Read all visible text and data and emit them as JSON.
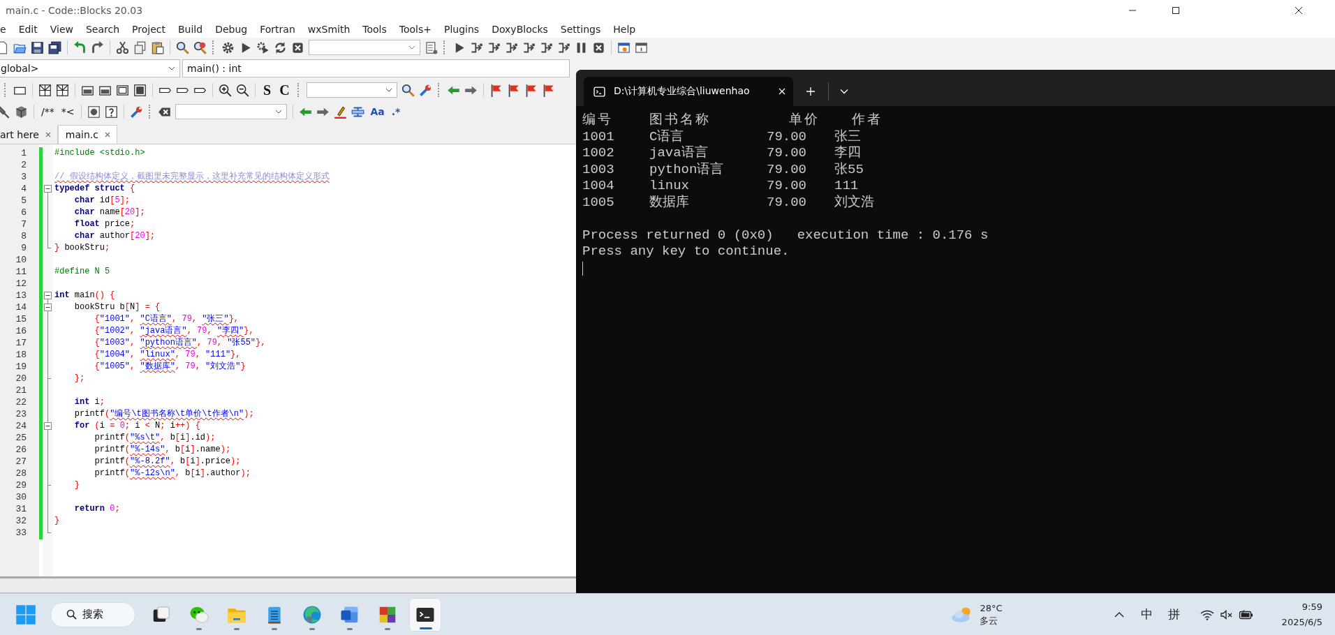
{
  "window": {
    "title": "main.c - Code::Blocks 20.03"
  },
  "menu": [
    "e",
    "Edit",
    "View",
    "Search",
    "Project",
    "Build",
    "Debug",
    "Fortran",
    "wxSmith",
    "Tools",
    "Tools+",
    "Plugins",
    "DoxyBlocks",
    "Settings",
    "Help"
  ],
  "toolbars": {
    "scope": "global>",
    "function": "main() : int",
    "wx_labels": [
      "S",
      "C"
    ],
    "doc_labels": [
      "/**",
      "*<"
    ],
    "search_labels": [
      "Aa",
      ".*"
    ]
  },
  "editor_tabs": [
    {
      "label": "art here",
      "selected": false
    },
    {
      "label": "main.c",
      "selected": true
    }
  ],
  "code": [
    {
      "number": "1",
      "tokens": [
        {
          "kind": "pp",
          "text": "#include <stdio.h>"
        }
      ]
    },
    {
      "number": "2"
    },
    {
      "number": "3",
      "tokens": [
        {
          "kind": "cm",
          "text": "// 假设结构体定义，截图里未完整显示，这里补充常见的结构体定义形式",
          "flagged": true
        }
      ]
    },
    {
      "number": "4",
      "collapsible": true,
      "tokens": [
        {
          "kind": "kw",
          "text": "typedef struct "
        },
        {
          "kind": "op",
          "text": "{"
        }
      ]
    },
    {
      "number": "5",
      "tokens": [
        {
          "kind": "kw",
          "text": "    char"
        },
        {
          "kind": "tx",
          "text": " id"
        },
        {
          "kind": "op",
          "text": "["
        },
        {
          "kind": "num",
          "text": "5"
        },
        {
          "kind": "op",
          "text": "];"
        }
      ]
    },
    {
      "number": "6",
      "tokens": [
        {
          "kind": "kw",
          "text": "    char"
        },
        {
          "kind": "tx",
          "text": " name"
        },
        {
          "kind": "op",
          "text": "["
        },
        {
          "kind": "num",
          "text": "20"
        },
        {
          "kind": "op",
          "text": "];"
        }
      ]
    },
    {
      "number": "7",
      "tokens": [
        {
          "kind": "kw",
          "text": "    float"
        },
        {
          "kind": "tx",
          "text": " price"
        },
        {
          "kind": "op",
          "text": ";"
        }
      ]
    },
    {
      "number": "8",
      "tokens": [
        {
          "kind": "kw",
          "text": "    char"
        },
        {
          "kind": "tx",
          "text": " author"
        },
        {
          "kind": "op",
          "text": "["
        },
        {
          "kind": "num",
          "text": "20"
        },
        {
          "kind": "op",
          "text": "];"
        }
      ]
    },
    {
      "number": "9",
      "fold_end": true,
      "tokens": [
        {
          "kind": "op",
          "text": "}"
        },
        {
          "kind": "tx",
          "text": " bookStru"
        },
        {
          "kind": "op",
          "text": ";"
        }
      ]
    },
    {
      "number": "10"
    },
    {
      "number": "11",
      "tokens": [
        {
          "kind": "pp",
          "text": "#define N 5"
        }
      ]
    },
    {
      "number": "12"
    },
    {
      "number": "13",
      "collapsible": true,
      "tokens": [
        {
          "kind": "kw",
          "text": "int"
        },
        {
          "kind": "tx",
          "text": " main"
        },
        {
          "kind": "op",
          "text": "() {"
        }
      ]
    },
    {
      "number": "14",
      "collapsible": true,
      "tokens": [
        {
          "kind": "tx",
          "text": "    bookStru b"
        },
        {
          "kind": "op",
          "text": "["
        },
        {
          "kind": "tx",
          "text": "N"
        },
        {
          "kind": "op",
          "text": "] = {"
        }
      ]
    },
    {
      "number": "15",
      "tokens": [
        {
          "kind": "op",
          "text": "        {"
        },
        {
          "kind": "str",
          "text": "\"1001\""
        },
        {
          "kind": "op",
          "text": ", "
        },
        {
          "kind": "str",
          "text": "\"C语言\"",
          "flagged": true
        },
        {
          "kind": "op",
          "text": ", "
        },
        {
          "kind": "num",
          "text": "79"
        },
        {
          "kind": "op",
          "text": ", "
        },
        {
          "kind": "str",
          "text": "\"张三\"",
          "flagged": true
        },
        {
          "kind": "op",
          "text": "},"
        }
      ]
    },
    {
      "number": "16",
      "tokens": [
        {
          "kind": "op",
          "text": "        {"
        },
        {
          "kind": "str",
          "text": "\"1002\""
        },
        {
          "kind": "op",
          "text": ", "
        },
        {
          "kind": "str",
          "text": "\"java语言\"",
          "flagged": true
        },
        {
          "kind": "op",
          "text": ", "
        },
        {
          "kind": "num",
          "text": "79"
        },
        {
          "kind": "op",
          "text": ", "
        },
        {
          "kind": "str",
          "text": "\"李四\"",
          "flagged": true
        },
        {
          "kind": "op",
          "text": "},"
        }
      ]
    },
    {
      "number": "17",
      "tokens": [
        {
          "kind": "op",
          "text": "        {"
        },
        {
          "kind": "str",
          "text": "\"1003\""
        },
        {
          "kind": "op",
          "text": ", "
        },
        {
          "kind": "str",
          "text": "\"python语言\"",
          "flagged": true
        },
        {
          "kind": "op",
          "text": ", "
        },
        {
          "kind": "num",
          "text": "79"
        },
        {
          "kind": "op",
          "text": ", "
        },
        {
          "kind": "str",
          "text": "\"张55\""
        },
        {
          "kind": "op",
          "text": "},"
        }
      ]
    },
    {
      "number": "18",
      "tokens": [
        {
          "kind": "op",
          "text": "        {"
        },
        {
          "kind": "str",
          "text": "\"1004\""
        },
        {
          "kind": "op",
          "text": ", "
        },
        {
          "kind": "str",
          "text": "\"linux\"",
          "flagged": true
        },
        {
          "kind": "op",
          "text": ", "
        },
        {
          "kind": "num",
          "text": "79"
        },
        {
          "kind": "op",
          "text": ", "
        },
        {
          "kind": "str",
          "text": "\"111\""
        },
        {
          "kind": "op",
          "text": "},"
        }
      ]
    },
    {
      "number": "19",
      "tokens": [
        {
          "kind": "op",
          "text": "        {"
        },
        {
          "kind": "str",
          "text": "\"1005\""
        },
        {
          "kind": "op",
          "text": ", "
        },
        {
          "kind": "str",
          "text": "\"数据库\"",
          "flagged": true
        },
        {
          "kind": "op",
          "text": ", "
        },
        {
          "kind": "num",
          "text": "79"
        },
        {
          "kind": "op",
          "text": ", "
        },
        {
          "kind": "str",
          "text": "\"刘文浩\""
        },
        {
          "kind": "op",
          "text": "}"
        }
      ]
    },
    {
      "number": "20",
      "fold_end": true,
      "tokens": [
        {
          "kind": "op",
          "text": "    };"
        }
      ]
    },
    {
      "number": "21"
    },
    {
      "number": "22",
      "tokens": [
        {
          "kind": "kw",
          "text": "    int"
        },
        {
          "kind": "tx",
          "text": " i"
        },
        {
          "kind": "op",
          "text": ";"
        }
      ]
    },
    {
      "number": "23",
      "tokens": [
        {
          "kind": "tx",
          "text": "    printf"
        },
        {
          "kind": "op",
          "text": "("
        },
        {
          "kind": "str",
          "text": "\"编号\\t图书名称\\t单价\\t作者\\n\"",
          "flagged": true
        },
        {
          "kind": "op",
          "text": ");"
        }
      ]
    },
    {
      "number": "24",
      "collapsible": true,
      "tokens": [
        {
          "kind": "kw",
          "text": "    for"
        },
        {
          "kind": "op",
          "text": " ("
        },
        {
          "kind": "tx",
          "text": "i "
        },
        {
          "kind": "op",
          "text": "= "
        },
        {
          "kind": "num",
          "text": "0"
        },
        {
          "kind": "op",
          "text": "; "
        },
        {
          "kind": "tx",
          "text": "i "
        },
        {
          "kind": "op",
          "text": "< "
        },
        {
          "kind": "tx",
          "text": "N"
        },
        {
          "kind": "op",
          "text": "; "
        },
        {
          "kind": "tx",
          "text": "i"
        },
        {
          "kind": "op",
          "text": "++) {"
        }
      ]
    },
    {
      "number": "25",
      "tokens": [
        {
          "kind": "tx",
          "text": "        printf"
        },
        {
          "kind": "op",
          "text": "("
        },
        {
          "kind": "str",
          "text": "\"%s\\t\"",
          "flagged": true
        },
        {
          "kind": "op",
          "text": ", "
        },
        {
          "kind": "tx",
          "text": "b"
        },
        {
          "kind": "op",
          "text": "["
        },
        {
          "kind": "tx",
          "text": "i"
        },
        {
          "kind": "op",
          "text": "]"
        },
        {
          "kind": "tx",
          "text": ".id"
        },
        {
          "kind": "op",
          "text": ");"
        }
      ]
    },
    {
      "number": "26",
      "tokens": [
        {
          "kind": "tx",
          "text": "        printf"
        },
        {
          "kind": "op",
          "text": "("
        },
        {
          "kind": "str",
          "text": "\"%-14s\"",
          "flagged": true
        },
        {
          "kind": "op",
          "text": ", "
        },
        {
          "kind": "tx",
          "text": "b"
        },
        {
          "kind": "op",
          "text": "["
        },
        {
          "kind": "tx",
          "text": "i"
        },
        {
          "kind": "op",
          "text": "]"
        },
        {
          "kind": "tx",
          "text": ".name"
        },
        {
          "kind": "op",
          "text": ");"
        }
      ]
    },
    {
      "number": "27",
      "tokens": [
        {
          "kind": "tx",
          "text": "        printf"
        },
        {
          "kind": "op",
          "text": "("
        },
        {
          "kind": "str",
          "text": "\"%-8.2f\"",
          "flagged": true
        },
        {
          "kind": "op",
          "text": ", "
        },
        {
          "kind": "tx",
          "text": "b"
        },
        {
          "kind": "op",
          "text": "["
        },
        {
          "kind": "tx",
          "text": "i"
        },
        {
          "kind": "op",
          "text": "]"
        },
        {
          "kind": "tx",
          "text": ".price"
        },
        {
          "kind": "op",
          "text": ");"
        }
      ]
    },
    {
      "number": "28",
      "tokens": [
        {
          "kind": "tx",
          "text": "        printf"
        },
        {
          "kind": "op",
          "text": "("
        },
        {
          "kind": "str",
          "text": "\"%-12s\\n\"",
          "flagged": true
        },
        {
          "kind": "op",
          "text": ", "
        },
        {
          "kind": "tx",
          "text": "b"
        },
        {
          "kind": "op",
          "text": "["
        },
        {
          "kind": "tx",
          "text": "i"
        },
        {
          "kind": "op",
          "text": "]"
        },
        {
          "kind": "tx",
          "text": ".author"
        },
        {
          "kind": "op",
          "text": ");"
        }
      ]
    },
    {
      "number": "29",
      "fold_end": true,
      "tokens": [
        {
          "kind": "op",
          "text": "    }"
        }
      ]
    },
    {
      "number": "30"
    },
    {
      "number": "31",
      "tokens": [
        {
          "kind": "kw",
          "text": "    return "
        },
        {
          "kind": "num",
          "text": "0"
        },
        {
          "kind": "op",
          "text": ";"
        }
      ]
    },
    {
      "number": "32",
      "tokens": [
        {
          "kind": "op",
          "text": "}"
        }
      ]
    },
    {
      "number": "33",
      "fold_end": true
    }
  ],
  "console": {
    "tab_title": "D:\\计算机专业综合\\liuwenhao",
    "header": [
      "编号",
      "图书名称",
      "单价",
      "作者"
    ],
    "rows": [
      [
        "1001",
        "C语言",
        "79.00",
        "张三"
      ],
      [
        "1002",
        "java语言",
        "79.00",
        "李四"
      ],
      [
        "1003",
        "python语言",
        "79.00",
        "张55"
      ],
      [
        "1004",
        "linux",
        "79.00",
        "111"
      ],
      [
        "1005",
        "数据库",
        "79.00",
        "刘文浩"
      ]
    ],
    "status": [
      "Process returned 0 (0x0)",
      "execution time : 0.176 s"
    ],
    "prompt": "Press any key to continue."
  },
  "taskbar": {
    "search": "搜索",
    "apps": [
      {
        "kind": "taskview",
        "running": false,
        "selected": false
      },
      {
        "kind": "chat",
        "running": true,
        "selected": false
      },
      {
        "kind": "folder",
        "running": true,
        "selected": false
      },
      {
        "kind": "notepad",
        "running": true,
        "selected": false
      },
      {
        "kind": "browser",
        "running": true,
        "selected": false
      },
      {
        "kind": "word",
        "running": true,
        "selected": false
      },
      {
        "kind": "blocks",
        "running": true,
        "selected": false
      },
      {
        "kind": "terminal",
        "running": true,
        "selected": true
      }
    ],
    "weather": {
      "temp": "28°C",
      "desc": "多云"
    },
    "ime": [
      "中",
      "拼"
    ],
    "time": "9:59",
    "date": "2025/6/5"
  }
}
